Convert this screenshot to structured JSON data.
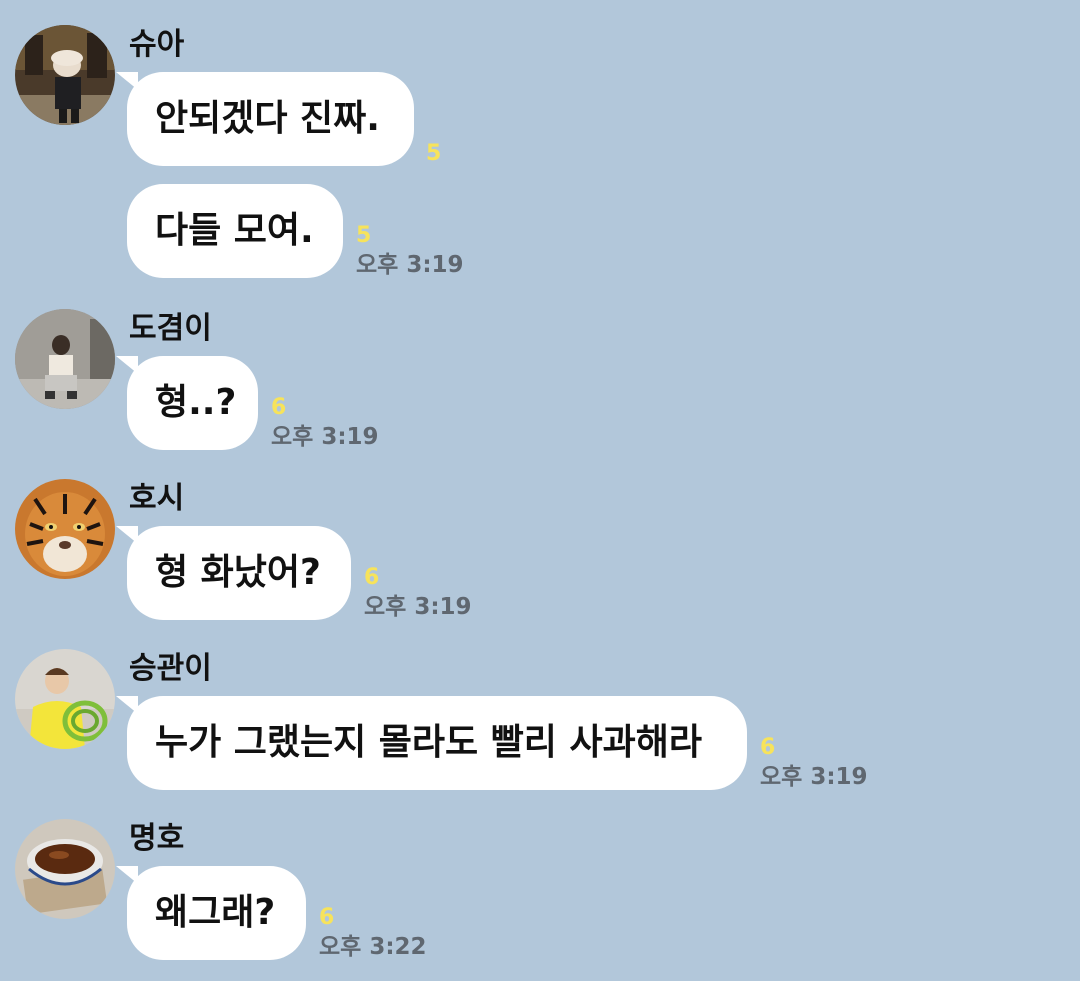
{
  "chat": {
    "groups": [
      {
        "sender": "슈아",
        "avatar_icon": "person-with-hat-photo-icon",
        "messages": [
          {
            "text": "안되겠다 진짜.",
            "unread": "5",
            "time": ""
          },
          {
            "text": "다들 모여.",
            "unread": "5",
            "time": "오후 3:19"
          }
        ]
      },
      {
        "sender": "도겸이",
        "avatar_icon": "person-crouching-photo-icon",
        "messages": [
          {
            "text": "형..?",
            "unread": "6",
            "time": "오후 3:19"
          }
        ]
      },
      {
        "sender": "호시",
        "avatar_icon": "tiger-photo-icon",
        "messages": [
          {
            "text": "형 화났어?",
            "unread": "6",
            "time": "오후 3:19"
          }
        ]
      },
      {
        "sender": "승관이",
        "avatar_icon": "person-yellow-shirt-photo-icon",
        "messages": [
          {
            "text": "누가 그랬는지 몰라도 빨리 사과해라",
            "unread": "6",
            "time": "오후 3:19"
          }
        ]
      },
      {
        "sender": "명호",
        "avatar_icon": "tea-cup-photo-icon",
        "messages": [
          {
            "text": "왜그래?",
            "unread": "6",
            "time": "오후 3:22"
          }
        ]
      }
    ]
  },
  "colors": {
    "background": "#b2c7da",
    "bubble": "#ffffff",
    "unread": "#f7e35b",
    "time": "#5f6770"
  }
}
